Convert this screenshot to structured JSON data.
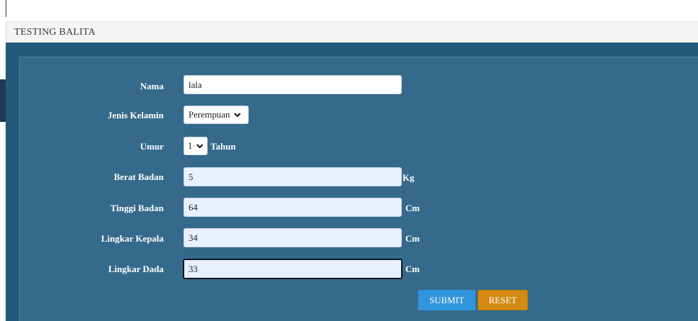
{
  "page": {
    "title": "TESTING BALITA"
  },
  "form": {
    "nama": {
      "label": "Nama",
      "value": "lala"
    },
    "jenis_kelamin": {
      "label": "Jenis Kelamin",
      "value": "Perempuan"
    },
    "umur": {
      "label": "Umur",
      "value": "1",
      "unit": "Tahun"
    },
    "berat_badan": {
      "label": "Berat Badan",
      "value": "5",
      "unit": "Kg"
    },
    "tinggi_badan": {
      "label": "Tinggi Badan",
      "value": "64",
      "unit": "Cm"
    },
    "lingkar_kepala": {
      "label": "Lingkar Kepala",
      "value": "34",
      "unit": "Cm"
    },
    "lingkar_dada": {
      "label": "Lingkar Dada",
      "value": "33",
      "unit": "Cm"
    }
  },
  "buttons": {
    "submit": "SUBMIT",
    "reset": "RESET"
  },
  "icons": {
    "dropdown": "chevron-down-icon"
  },
  "colors": {
    "outer_panel": "#23597a",
    "inner_panel": "#356a8c",
    "submit": "#2f95dc",
    "reset": "#d48a12"
  }
}
